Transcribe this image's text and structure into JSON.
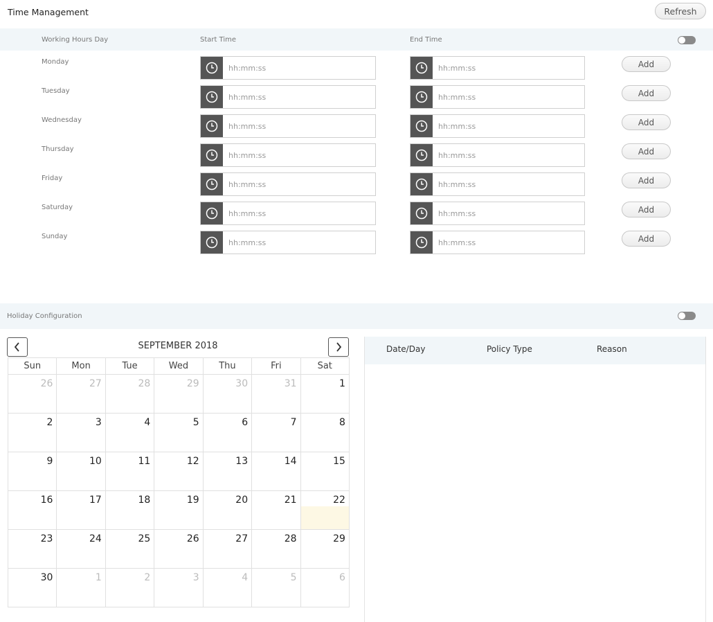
{
  "header": {
    "title": "Time Management",
    "refresh_label": "Refresh"
  },
  "working_hours": {
    "columns": {
      "day": "Working Hours Day",
      "start": "Start Time",
      "end": "End Time"
    },
    "toggle_on": false,
    "placeholder": "hh:mm:ss",
    "add_label": "Add",
    "days": [
      {
        "label": "Monday",
        "start": "",
        "end": ""
      },
      {
        "label": "Tuesday",
        "start": "",
        "end": ""
      },
      {
        "label": "Wednesday",
        "start": "",
        "end": ""
      },
      {
        "label": "Thursday",
        "start": "",
        "end": ""
      },
      {
        "label": "Friday",
        "start": "",
        "end": ""
      },
      {
        "label": "Saturday",
        "start": "",
        "end": ""
      },
      {
        "label": "Sunday",
        "start": "",
        "end": ""
      }
    ]
  },
  "holiday": {
    "title": "Holiday Configuration",
    "toggle_on": false,
    "calendar": {
      "month_label": "SEPTEMBER 2018",
      "weekdays": [
        "Sun",
        "Mon",
        "Tue",
        "Wed",
        "Thu",
        "Fri",
        "Sat"
      ],
      "today": 22,
      "weeks": [
        [
          {
            "d": 26,
            "o": true
          },
          {
            "d": 27,
            "o": true
          },
          {
            "d": 28,
            "o": true
          },
          {
            "d": 29,
            "o": true
          },
          {
            "d": 30,
            "o": true
          },
          {
            "d": 31,
            "o": true
          },
          {
            "d": 1,
            "o": false
          }
        ],
        [
          {
            "d": 2,
            "o": false
          },
          {
            "d": 3,
            "o": false
          },
          {
            "d": 4,
            "o": false
          },
          {
            "d": 5,
            "o": false
          },
          {
            "d": 6,
            "o": false
          },
          {
            "d": 7,
            "o": false
          },
          {
            "d": 8,
            "o": false
          }
        ],
        [
          {
            "d": 9,
            "o": false
          },
          {
            "d": 10,
            "o": false
          },
          {
            "d": 11,
            "o": false
          },
          {
            "d": 12,
            "o": false
          },
          {
            "d": 13,
            "o": false
          },
          {
            "d": 14,
            "o": false
          },
          {
            "d": 15,
            "o": false
          }
        ],
        [
          {
            "d": 16,
            "o": false
          },
          {
            "d": 17,
            "o": false
          },
          {
            "d": 18,
            "o": false
          },
          {
            "d": 19,
            "o": false
          },
          {
            "d": 20,
            "o": false
          },
          {
            "d": 21,
            "o": false
          },
          {
            "d": 22,
            "o": false
          }
        ],
        [
          {
            "d": 23,
            "o": false
          },
          {
            "d": 24,
            "o": false
          },
          {
            "d": 25,
            "o": false
          },
          {
            "d": 26,
            "o": false
          },
          {
            "d": 27,
            "o": false
          },
          {
            "d": 28,
            "o": false
          },
          {
            "d": 29,
            "o": false
          }
        ],
        [
          {
            "d": 30,
            "o": false
          },
          {
            "d": 1,
            "o": true
          },
          {
            "d": 2,
            "o": true
          },
          {
            "d": 3,
            "o": true
          },
          {
            "d": 4,
            "o": true
          },
          {
            "d": 5,
            "o": true
          },
          {
            "d": 6,
            "o": true
          }
        ]
      ]
    },
    "table": {
      "columns": [
        "Date/Day",
        "Policy Type",
        "Reason"
      ],
      "rows": []
    }
  },
  "icons": {
    "clock": "clock-icon",
    "prev": "chevron-left-icon",
    "next": "chevron-right-icon"
  }
}
